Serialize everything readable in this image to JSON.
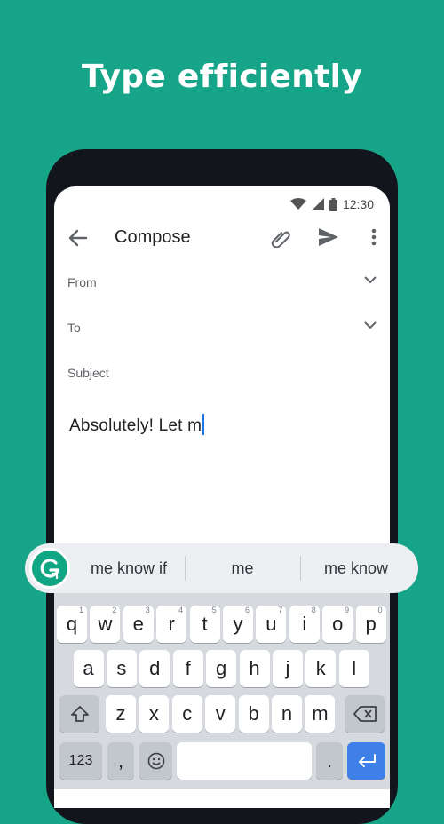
{
  "headline": "Type efficiently",
  "status": {
    "time": "12:30"
  },
  "appbar": {
    "title": "Compose"
  },
  "fields": {
    "from_label": "From",
    "to_label": "To",
    "subject_label": "Subject"
  },
  "body_text": "Absolutely! Let m",
  "suggestions": [
    "me know if",
    "me",
    "me know"
  ],
  "keyboard": {
    "row1": [
      {
        "l": "q",
        "n": "1"
      },
      {
        "l": "w",
        "n": "2"
      },
      {
        "l": "e",
        "n": "3"
      },
      {
        "l": "r",
        "n": "4"
      },
      {
        "l": "t",
        "n": "5"
      },
      {
        "l": "y",
        "n": "6"
      },
      {
        "l": "u",
        "n": "7"
      },
      {
        "l": "i",
        "n": "8"
      },
      {
        "l": "o",
        "n": "9"
      },
      {
        "l": "p",
        "n": "0"
      }
    ],
    "row2": [
      "a",
      "s",
      "d",
      "f",
      "g",
      "h",
      "j",
      "k",
      "l"
    ],
    "row3": [
      "z",
      "x",
      "c",
      "v",
      "b",
      "n",
      "m"
    ],
    "numbers_key": "123",
    "comma_key": ",",
    "period_key": "."
  },
  "colors": {
    "background": "#17a589",
    "accent": "#3f7fe8",
    "grammarly": "#11a683"
  }
}
